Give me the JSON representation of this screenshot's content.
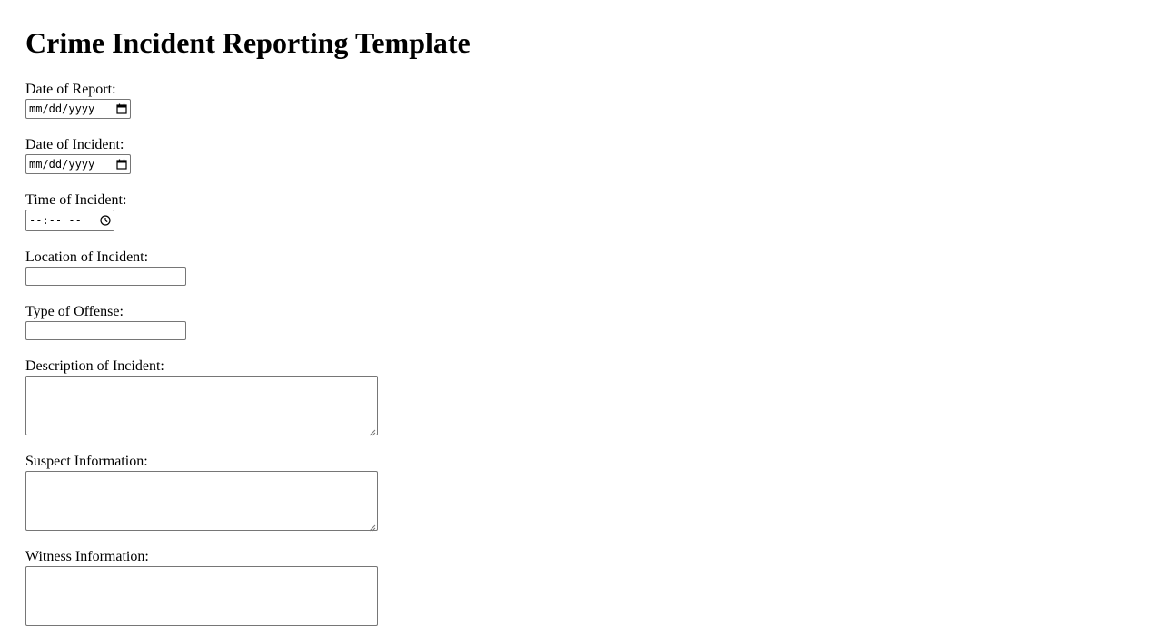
{
  "page": {
    "title": "Crime Incident Reporting Template"
  },
  "form": {
    "date_of_report": {
      "label": "Date of Report:",
      "placeholder": "mm/dd/yyyy",
      "icon": "calendar-icon"
    },
    "date_of_incident": {
      "label": "Date of Incident:",
      "placeholder": "mm/dd/yyyy",
      "icon": "calendar-icon"
    },
    "time_of_incident": {
      "label": "Time of Incident:",
      "placeholder": "--:-- --",
      "icon": "clock-icon"
    },
    "location_of_incident": {
      "label": "Location of Incident:",
      "value": ""
    },
    "type_of_offense": {
      "label": "Type of Offense:",
      "value": ""
    },
    "description_of_incident": {
      "label": "Description of Incident:",
      "value": ""
    },
    "suspect_information": {
      "label": "Suspect Information:",
      "value": ""
    },
    "witness_information": {
      "label": "Witness Information:",
      "value": ""
    }
  }
}
